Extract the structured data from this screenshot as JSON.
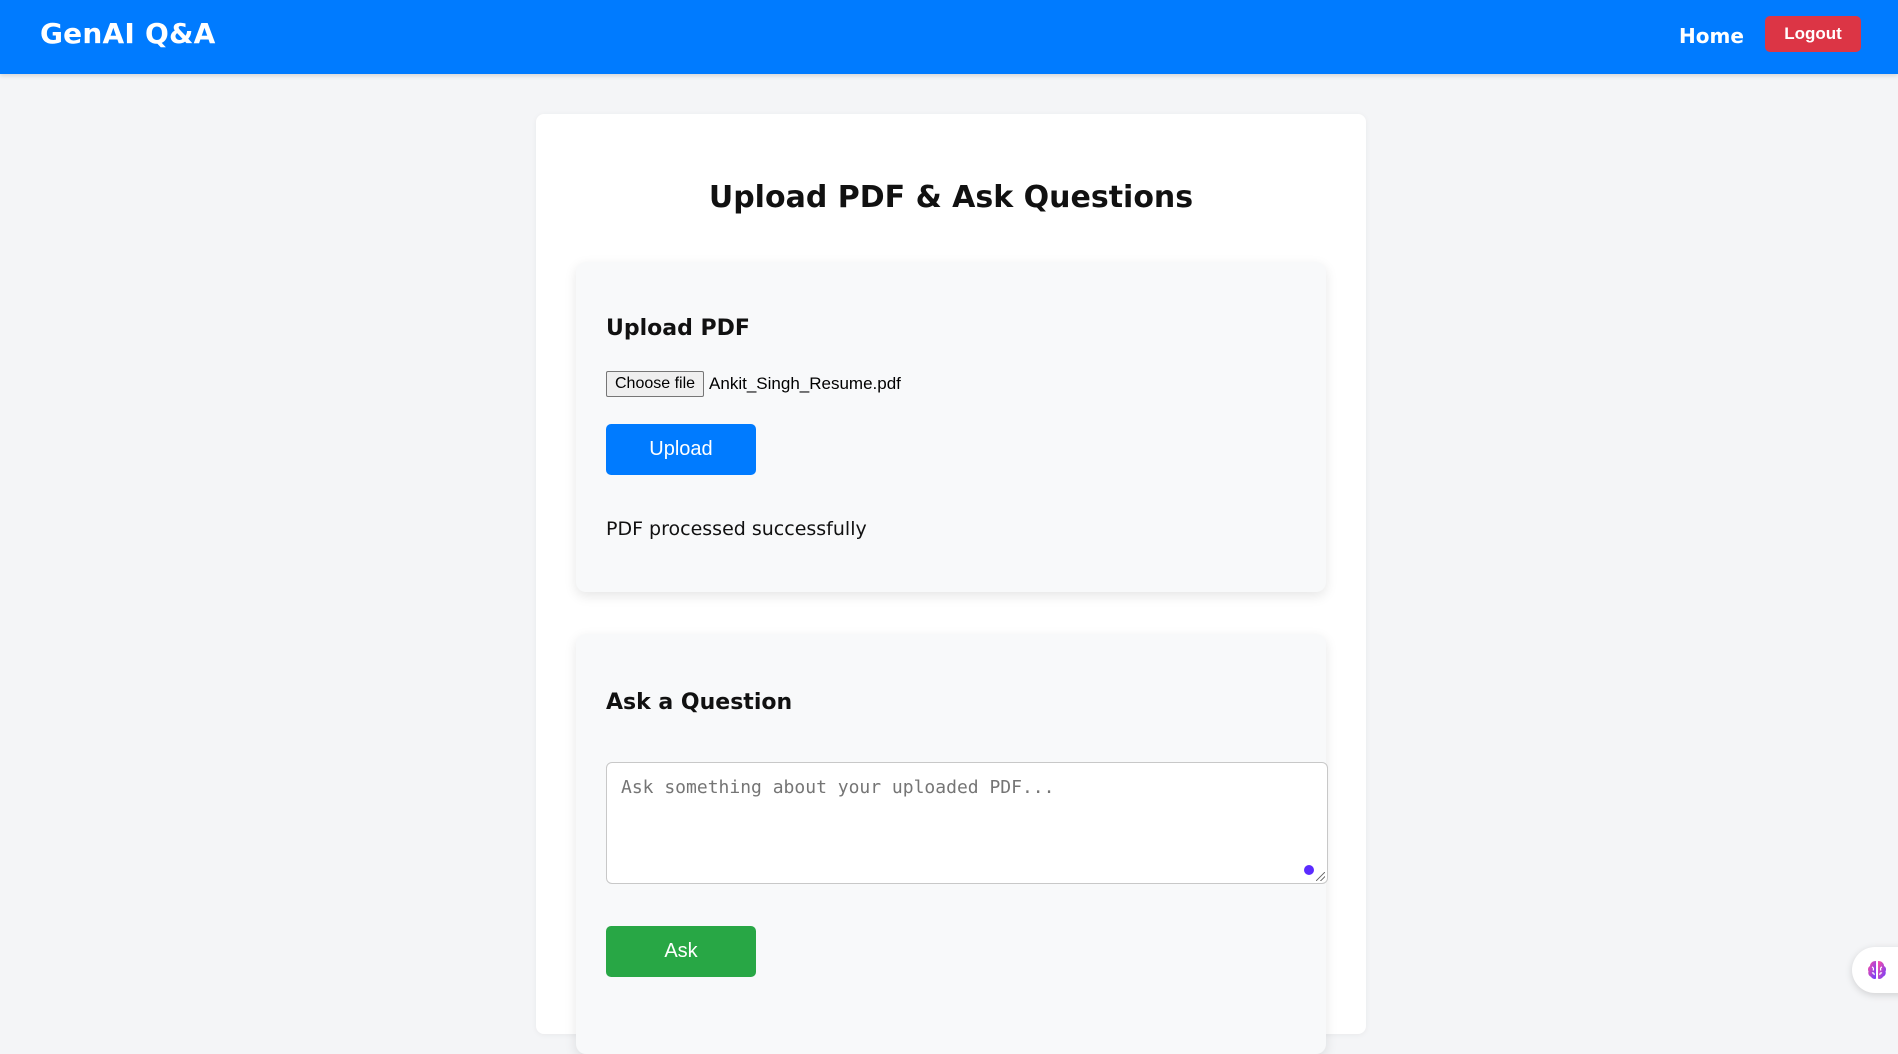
{
  "navbar": {
    "brand": "GenAI Q&A",
    "home_label": "Home",
    "logout_label": "Logout",
    "colors": {
      "background": "#007bff",
      "logout": "#dc3545"
    }
  },
  "page": {
    "title": "Upload PDF & Ask Questions"
  },
  "upload_section": {
    "heading": "Upload PDF",
    "choose_file_label": "Choose file",
    "selected_file": "Ankit_Singh_Resume.pdf",
    "upload_label": "Upload",
    "status_message": "PDF processed successfully",
    "button_color": "#007bff"
  },
  "ask_section": {
    "heading": "Ask a Question",
    "question_value": "",
    "question_placeholder": "Ask something about your uploaded PDF...",
    "ask_label": "Ask",
    "button_color": "#28a745"
  },
  "icons": {
    "grammar_assistant": "grammar-check-icon",
    "extension": "brain-icon"
  }
}
